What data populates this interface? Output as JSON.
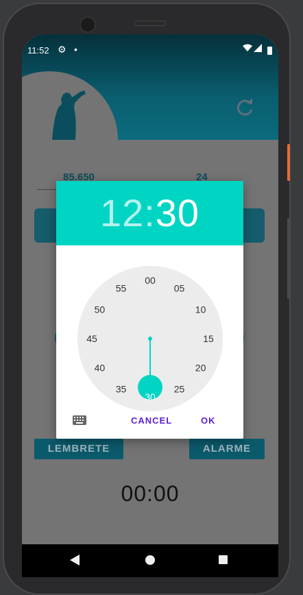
{
  "status_bar": {
    "time": "11:52",
    "settings_icon": "gear-icon",
    "notification_icon": "dot-icon",
    "wifi_icon": "wifi-icon",
    "signal_icon": "signal-icon",
    "battery_icon": "battery-icon"
  },
  "app": {
    "header_icons": [
      "drinking-person-icon",
      "refresh-icon"
    ],
    "weight_value": "85.650",
    "age_value": "24",
    "lembrete_label": "LEMBRETE",
    "alarme_label": "ALARME",
    "timer": "00:00"
  },
  "time_picker": {
    "hours": "12",
    "separator": ":",
    "minutes": "30",
    "dial_minutes": [
      "00",
      "05",
      "10",
      "15",
      "20",
      "25",
      "30",
      "35",
      "40",
      "45",
      "50",
      "55"
    ],
    "selected_minute": "30",
    "keyboard_icon": "keyboard-icon",
    "cancel_label": "CANCEL",
    "ok_label": "OK",
    "accent_color": "#00d5c3",
    "action_color": "#5b1fd6"
  },
  "nav_bar": {
    "icons": [
      "back-icon",
      "home-icon",
      "recents-icon"
    ]
  }
}
